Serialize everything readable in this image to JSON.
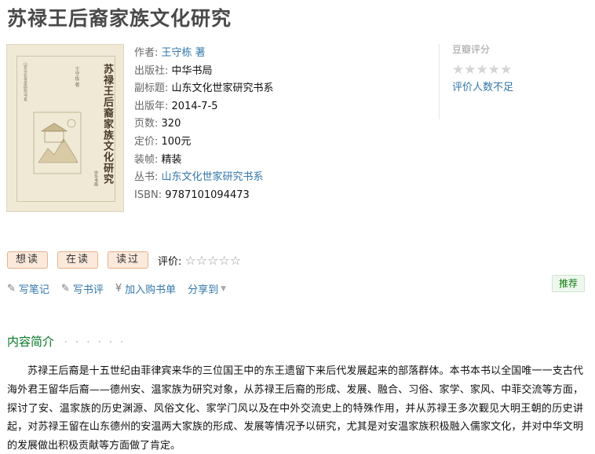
{
  "title": "苏禄王后裔家族文化研究",
  "cover": {
    "vertical_title": "苏禄王后裔家族文化研究",
    "author_small": "王守栋 著",
    "series_small": "山东文化世家研究书系",
    "publisher_small": "中华书局"
  },
  "info": {
    "author_label": "作者:",
    "author_value": "王守栋 著",
    "publisher_label": "出版社:",
    "publisher_value": "中华书局",
    "subtitle_label": "副标题:",
    "subtitle_value": "山东文化世家研究书系",
    "pubdate_label": "出版年:",
    "pubdate_value": "2014-7-5",
    "pages_label": "页数:",
    "pages_value": "320",
    "price_label": "定价:",
    "price_value": "100元",
    "binding_label": "装帧:",
    "binding_value": "精装",
    "series_label": "丛书:",
    "series_value": "山东文化世家研究书系",
    "isbn_label": "ISBN:",
    "isbn_value": "9787101094473"
  },
  "rating": {
    "title": "豆瓣评分",
    "stars": "★★★★★",
    "note": "评价人数不足"
  },
  "actions": {
    "want": "想读",
    "reading": "在读",
    "read": "读过",
    "rate_label": "评价:",
    "rate_stars": "☆☆☆☆☆"
  },
  "links": {
    "write_note": "写笔记",
    "write_review": "写书评",
    "add_cart": "加入购书单",
    "share": "分享到"
  },
  "recommend": "推荐",
  "section": {
    "title": "内容简介",
    "dots": "· · · · · ·"
  },
  "intro": "苏禄王后裔是十五世纪由菲律宾来华的三位国王中的东王遗留下来后代发展起来的部落群体。本书本书以全国唯一一支古代海外君王留华后裔——德州安、温家族为研究对象，从苏禄王后裔的形成、发展、融合、习俗、家学、家风、中菲交流等方面，探讨了安、温家族的历史渊源、风俗文化、家学门风以及在中外交流史上的特殊作用，并从苏禄王多次觐见大明王朝的历史讲起，对苏禄王留在山东德州的安温两大家族的形成、发展等情况予以研究，尤其是对安温家族积极融入儒家文化，并对中华文明的发展做出积极贡献等方面做了肯定。"
}
